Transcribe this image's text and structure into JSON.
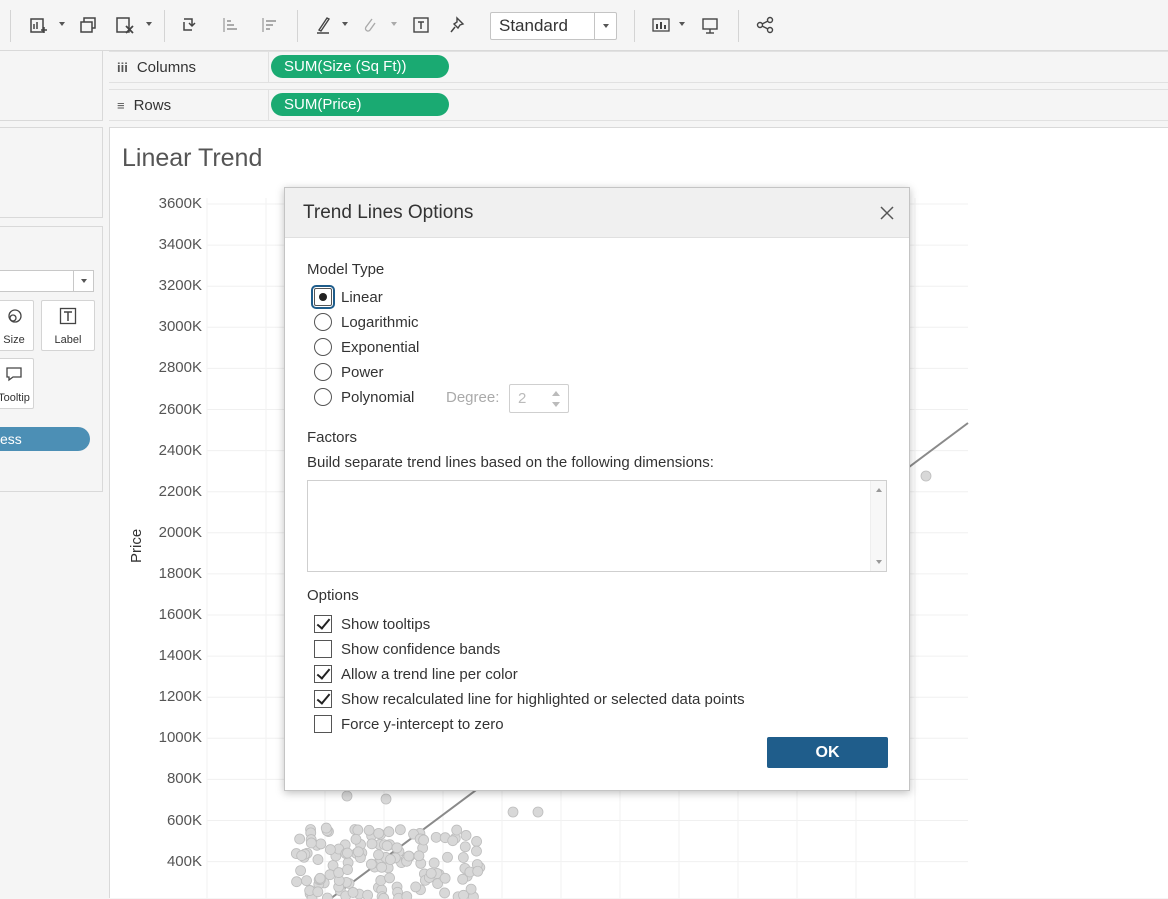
{
  "toolbar": {
    "icons": [
      "new-worksheet-icon",
      "duplicate-icon",
      "clear-sheet-icon",
      "swap-icon",
      "sort-ascending-icon",
      "sort-descending-icon",
      "highlight-icon",
      "group-icon",
      "label-text-icon",
      "pin-icon",
      "show-me-icon",
      "presentation-icon",
      "share-icon"
    ],
    "view_size": "Standard"
  },
  "shelves": {
    "columns_label": "Columns",
    "columns_pill": "SUM(Size (Sq Ft))",
    "rows_label": "Rows",
    "rows_pill": "SUM(Price)"
  },
  "marks": {
    "size_label": "Size",
    "label_label": "Label",
    "tooltip_label": "Tooltip",
    "field_pill": "ess"
  },
  "view": {
    "title": "Linear Trend",
    "ylabel": "Price",
    "yticks": [
      "3600K",
      "3400K",
      "3200K",
      "3000K",
      "2800K",
      "2600K",
      "2400K",
      "2200K",
      "2000K",
      "1800K",
      "1600K",
      "1400K",
      "1200K",
      "1000K",
      "800K",
      "600K",
      "400K"
    ]
  },
  "dialog": {
    "title": "Trend Lines Options",
    "model_type_heading": "Model Type",
    "models": [
      {
        "label": "Linear",
        "selected": true
      },
      {
        "label": "Logarithmic",
        "selected": false
      },
      {
        "label": "Exponential",
        "selected": false
      },
      {
        "label": "Power",
        "selected": false
      },
      {
        "label": "Polynomial",
        "selected": false
      }
    ],
    "degree_label": "Degree:",
    "degree_value": "2",
    "factors_heading": "Factors",
    "factors_desc": "Build separate trend lines based on the following dimensions:",
    "options_heading": "Options",
    "options": [
      {
        "label": "Show tooltips",
        "checked": true
      },
      {
        "label": "Show confidence bands",
        "checked": false
      },
      {
        "label": "Allow a trend line per color",
        "checked": true
      },
      {
        "label": "Show recalculated line for highlighted or selected data points",
        "checked": true
      },
      {
        "label": "Force y-intercept to zero",
        "checked": false
      }
    ],
    "ok_label": "OK"
  },
  "colors": {
    "pill_green": "#1aaa72",
    "ok_blue": "#1f5d8b",
    "field_pill_blue": "#4c8fb5"
  }
}
